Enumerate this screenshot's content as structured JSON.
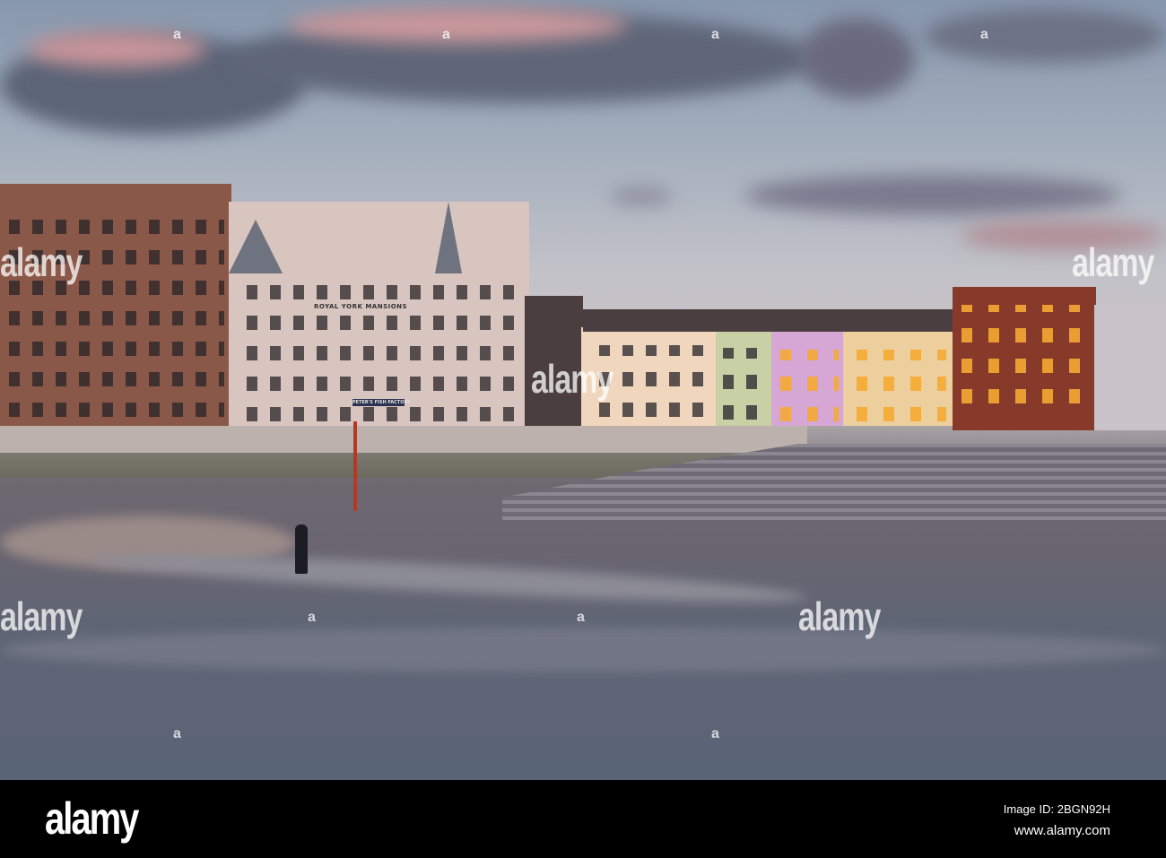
{
  "scene": {
    "building_sign": "ROYAL YORK MANSIONS",
    "shop_sign": "PETER'S FISH FACTORY"
  },
  "watermark": {
    "text": "alamy",
    "dot": "a"
  },
  "footer": {
    "logo": "alamy",
    "image_id": "Image ID: 2BGN92H",
    "url": "www.alamy.com"
  }
}
